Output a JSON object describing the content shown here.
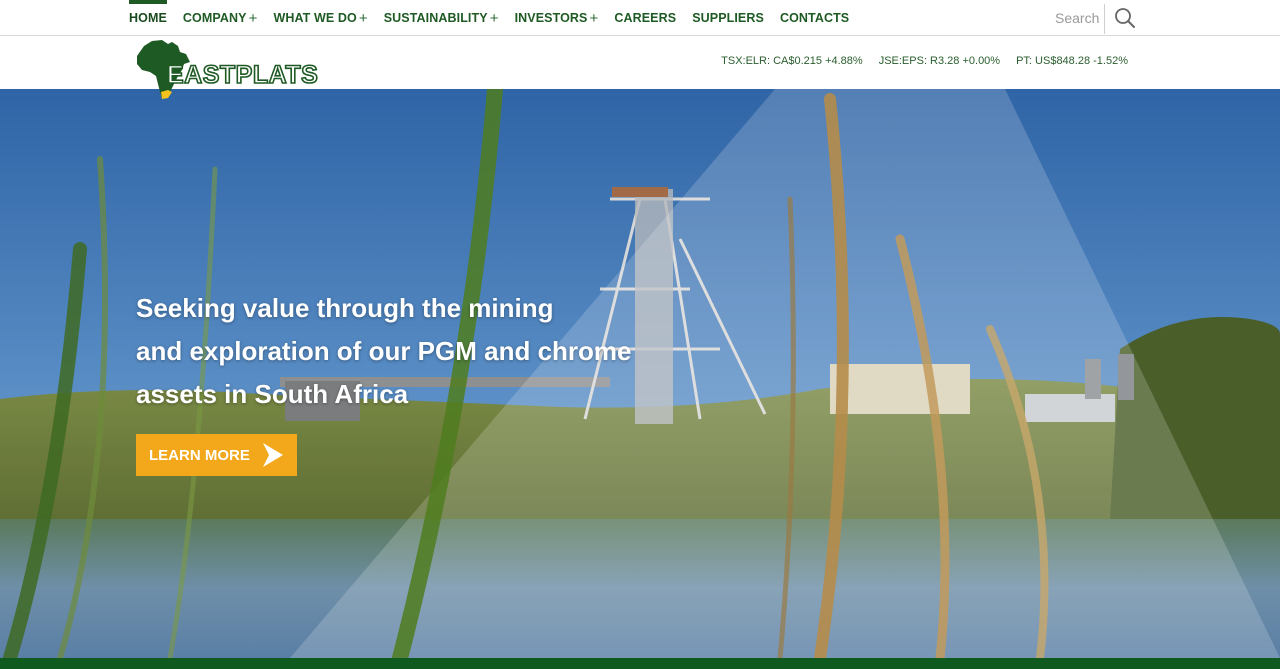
{
  "nav": {
    "items": [
      {
        "label": "HOME",
        "plus": ""
      },
      {
        "label": "COMPANY",
        "plus": "+"
      },
      {
        "label": "WHAT WE DO",
        "plus": "+"
      },
      {
        "label": "SUSTAINABILITY",
        "plus": "+"
      },
      {
        "label": "INVESTORS",
        "plus": "+"
      },
      {
        "label": "CAREERS",
        "plus": ""
      },
      {
        "label": "SUPPLIERS",
        "plus": ""
      },
      {
        "label": "CONTACTS",
        "plus": ""
      }
    ],
    "active": "HOME"
  },
  "search": {
    "placeholder": "Search"
  },
  "brand": {
    "logo_text": "EASTPLATS"
  },
  "tickers": [
    {
      "text": "TSX:ELR: CA$0.215 +4.88%"
    },
    {
      "text": "JSE:EPS: R3.28 +0.00%"
    },
    {
      "text": "PT: US$848.28 -1.52%"
    }
  ],
  "hero": {
    "line1": "Seeking value through the mining",
    "line2": "and exploration of our PGM and chrome",
    "line3": "assets in South Africa",
    "button_label": "LEARN MORE"
  },
  "colors": {
    "brand_green": "#1e5a23",
    "accent_orange": "#f3a81c",
    "footer_green": "#0f5a1f"
  },
  "icons": {
    "search": "search-icon",
    "button_arrow": "arrow-right-icon",
    "logo_map": "africa-map-icon"
  }
}
